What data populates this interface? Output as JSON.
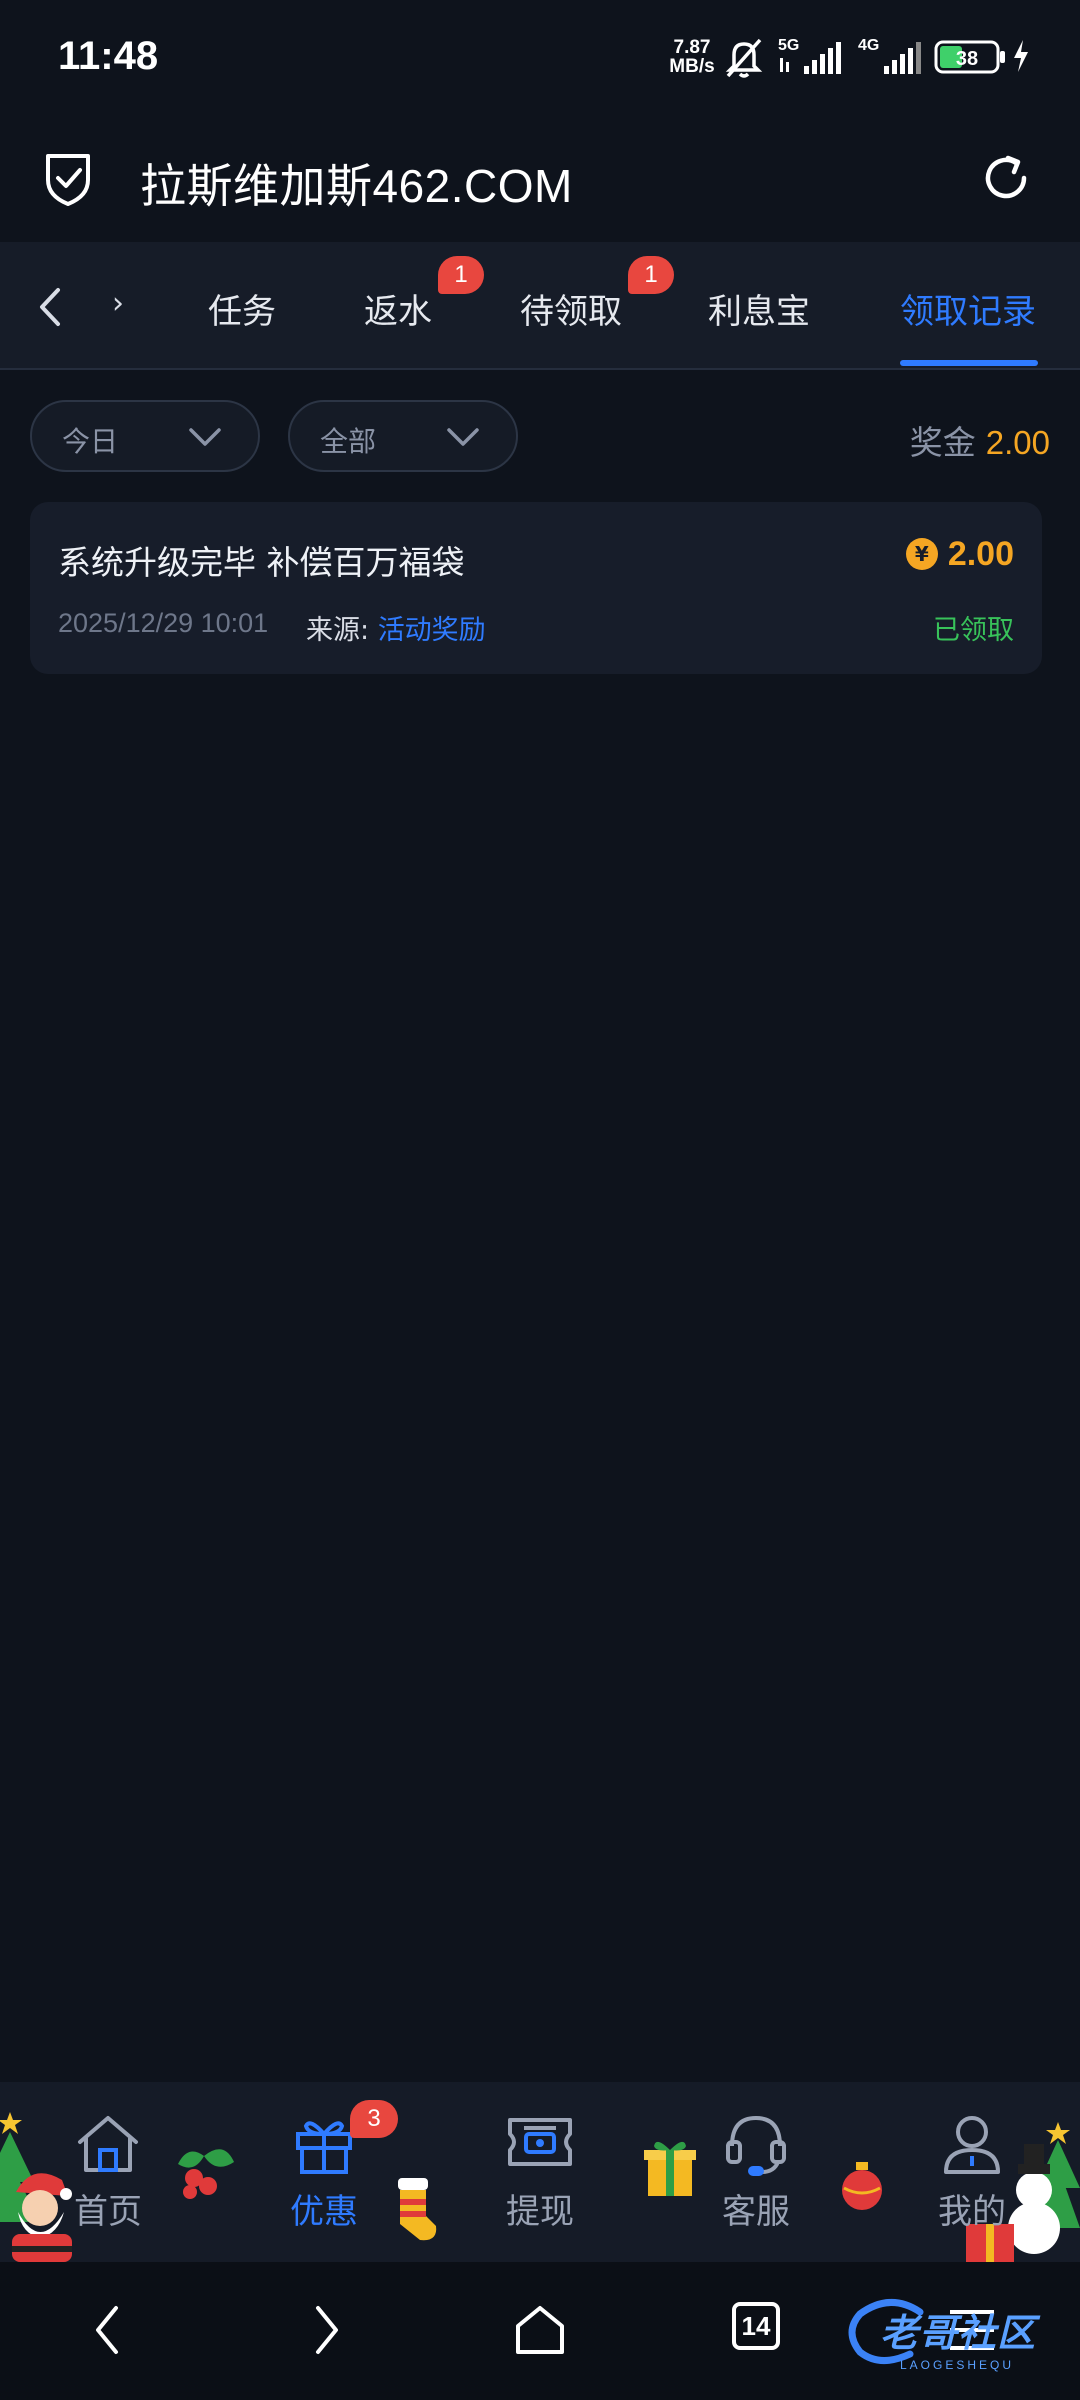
{
  "status_bar": {
    "time": "11:48",
    "net_speed_value": "7.87",
    "net_speed_unit": "MB/s",
    "signal_1_label": "5G",
    "signal_2_label": "4G",
    "battery_level": "38"
  },
  "header": {
    "title": "拉斯维加斯462.COM"
  },
  "tabs": {
    "cut_label": "›",
    "items": [
      {
        "label": "任务",
        "badge": ""
      },
      {
        "label": "返水",
        "badge": "1"
      },
      {
        "label": "待领取",
        "badge": "1"
      },
      {
        "label": "利息宝",
        "badge": ""
      },
      {
        "label": "领取记录",
        "badge": ""
      }
    ],
    "active_index": 4
  },
  "filters": {
    "date_value": "今日",
    "type_value": "全部",
    "bonus_label": "奖金",
    "bonus_value": "2.00"
  },
  "records": [
    {
      "title": "系统升级完毕 补偿百万福袋",
      "coin_symbol": "¥",
      "amount": "2.00",
      "time": "2025/12/29 10:01",
      "source_label": "来源: ",
      "source_value": "活动奖励",
      "status": "已领取"
    }
  ],
  "bottom_nav": {
    "items": [
      {
        "label": "首页",
        "icon": "home-icon"
      },
      {
        "label": "优惠",
        "icon": "gift-icon",
        "badge": "3"
      },
      {
        "label": "提现",
        "icon": "withdraw-ticket-icon"
      },
      {
        "label": "客服",
        "icon": "headset-icon"
      },
      {
        "label": "我的",
        "icon": "user-icon"
      }
    ]
  },
  "system_nav": {
    "tab_count": "14",
    "watermark": "老哥社区",
    "watermark_sub": "LAOGESHEQU"
  },
  "colors": {
    "background": "#0e131c",
    "accent_blue": "#2f7bff",
    "gold": "#f5a623",
    "success_green": "#38c25a",
    "badge_red": "#e8473f"
  }
}
